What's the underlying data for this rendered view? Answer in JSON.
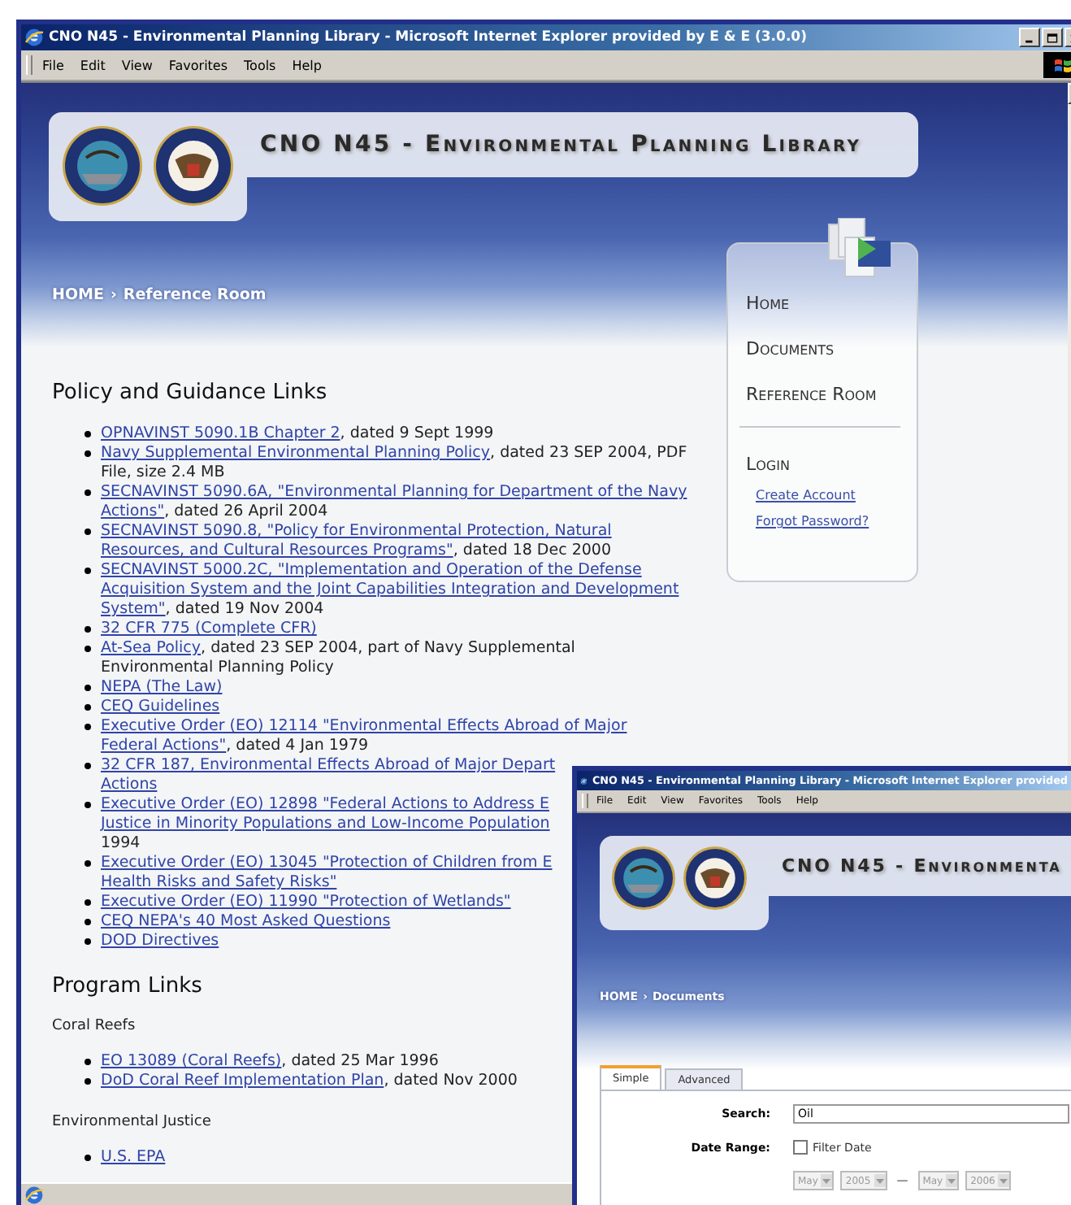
{
  "window": {
    "title": "CNO N45 - Environmental Planning Library - Microsoft Internet Explorer provided by E & E (3.0.0)"
  },
  "menu": [
    "File",
    "Edit",
    "View",
    "Favorites",
    "Tools",
    "Help"
  ],
  "banner": {
    "title": "CNO N45 - Environmental Planning Library"
  },
  "breadcrumb": {
    "home": "HOME",
    "separator": "›",
    "current": "Reference Room"
  },
  "nav": {
    "items": [
      "Home",
      "Documents",
      "Reference Room"
    ],
    "login": {
      "label": "Login",
      "links": [
        "Create Account",
        "Forgot Password?"
      ]
    }
  },
  "sections": [
    {
      "heading": "Policy and Guidance Links",
      "groups": [
        {
          "items": [
            {
              "lines": [
                {
                  "link": "OPNAVINST 5090.1B Chapter 2",
                  "text": ", dated 9 Sept 1999"
                }
              ]
            },
            {
              "lines": [
                {
                  "link": "Navy Supplemental Environmental Planning Policy",
                  "text": ", dated 23 SEP 2004, PDF"
                },
                {
                  "text": "File, size 2.4 MB"
                }
              ]
            },
            {
              "lines": [
                {
                  "link": "SECNAVINST 5090.6A, \"Environmental Planning for Department of the Navy"
                },
                {
                  "link": "Actions\"",
                  "text": ", dated 26 April 2004"
                }
              ]
            },
            {
              "lines": [
                {
                  "link": "SECNAVINST 5090.8, \"Policy for Environmental Protection, Natural"
                },
                {
                  "link": "Resources, and Cultural Resources Programs\"",
                  "text": ", dated 18 Dec 2000"
                }
              ]
            },
            {
              "lines": [
                {
                  "link": "SECNAVINST 5000.2C, \"Implementation and Operation of the Defense"
                },
                {
                  "link": "Acquisition System and the Joint Capabilities Integration and Development"
                },
                {
                  "link": "System\"",
                  "text": ", dated 19 Nov 2004"
                }
              ]
            },
            {
              "lines": [
                {
                  "link": "32 CFR 775 (Complete CFR)"
                }
              ]
            },
            {
              "lines": [
                {
                  "link": "At-Sea Policy",
                  "text": ", dated 23 SEP 2004, part of Navy Supplemental"
                },
                {
                  "text": "Environmental Planning Policy"
                }
              ]
            },
            {
              "lines": [
                {
                  "link": "NEPA (The Law)"
                }
              ]
            },
            {
              "lines": [
                {
                  "link": "CEQ Guidelines"
                }
              ]
            },
            {
              "lines": [
                {
                  "link": "Executive Order (EO) 12114 \"Environmental Effects Abroad of Major"
                },
                {
                  "link": "Federal Actions\"",
                  "text": ", dated 4 Jan 1979"
                }
              ]
            },
            {
              "lines": [
                {
                  "link": "32 CFR 187, Environmental Effects Abroad of Major Depart"
                },
                {
                  "link": "Actions"
                }
              ]
            },
            {
              "lines": [
                {
                  "link": "Executive Order (EO) 12898 \"Federal Actions to Address E"
                },
                {
                  "link": "Justice in Minority Populations and Low-Income Population"
                },
                {
                  "text": "1994"
                }
              ]
            },
            {
              "lines": [
                {
                  "link": "Executive Order (EO) 13045 \"Protection of Children from E"
                },
                {
                  "link": "Health Risks and Safety Risks\""
                }
              ]
            },
            {
              "lines": [
                {
                  "link": "Executive Order (EO) 11990 \"Protection of Wetlands\""
                }
              ]
            },
            {
              "lines": [
                {
                  "link": "CEQ NEPA's 40 Most Asked Questions"
                }
              ]
            },
            {
              "lines": [
                {
                  "link": "DOD Directives"
                }
              ]
            }
          ]
        }
      ]
    },
    {
      "heading": "Program Links",
      "groups": [
        {
          "label": "Coral Reefs",
          "items": [
            {
              "lines": [
                {
                  "link": "EO 13089 (Coral Reefs)",
                  "text": ", dated 25 Mar 1996"
                }
              ]
            },
            {
              "lines": [
                {
                  "link": "DoD Coral Reef Implementation Plan",
                  "text": ", dated Nov 2000"
                }
              ]
            }
          ]
        },
        {
          "label": "Environmental Justice",
          "items": [
            {
              "lines": [
                {
                  "link": "U.S. EPA"
                }
              ]
            }
          ]
        }
      ]
    }
  ],
  "second_window": {
    "title": "CNO N45 - Environmental Planning Library - Microsoft Internet Explorer provided",
    "menu": [
      "File",
      "Edit",
      "View",
      "Favorites",
      "Tools",
      "Help"
    ],
    "banner": {
      "title": "CNO N45 - Environmenta"
    },
    "breadcrumb": {
      "home": "HOME",
      "separator": "›",
      "current": "Documents"
    },
    "tabs": [
      {
        "label": "Simple",
        "selected": true
      },
      {
        "label": "Advanced",
        "selected": false
      }
    ],
    "search": {
      "label": "Search:",
      "value": "Oil"
    },
    "date_range": {
      "label": "Date Range:",
      "filter": {
        "label": "Filter Date",
        "checked": false
      },
      "from": {
        "month": "May",
        "year": "2005"
      },
      "dash": "—",
      "to": {
        "month": "May",
        "year": "2006"
      }
    }
  }
}
